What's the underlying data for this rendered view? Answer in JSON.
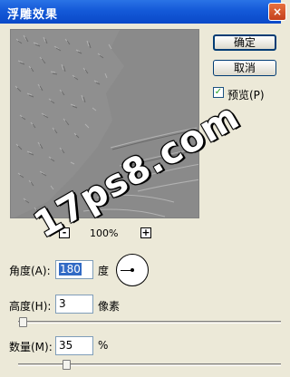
{
  "window": {
    "title": "浮雕效果",
    "close_glyph": "×"
  },
  "buttons": {
    "ok_label": "确定",
    "cancel_label": "取消"
  },
  "preview": {
    "label": "预览(P)",
    "checked": true,
    "check_glyph": "✓"
  },
  "zoom": {
    "minus_label": "-",
    "value": "100%",
    "plus_label": "+"
  },
  "angle": {
    "label": "角度(A):",
    "value": "180",
    "unit": "度"
  },
  "height": {
    "label": "高度(H):",
    "value": "3",
    "unit": "像素",
    "slider_level": 0.01
  },
  "amount": {
    "label": "数量(M):",
    "value": "35",
    "unit": "%",
    "slider_level": 0.18
  },
  "watermark": {
    "text": "17ps8.com"
  },
  "colors": {
    "titlebar": "#0a49c8",
    "dialog_bg": "#ece9d8",
    "preview_gray": "#8b8b8b"
  }
}
